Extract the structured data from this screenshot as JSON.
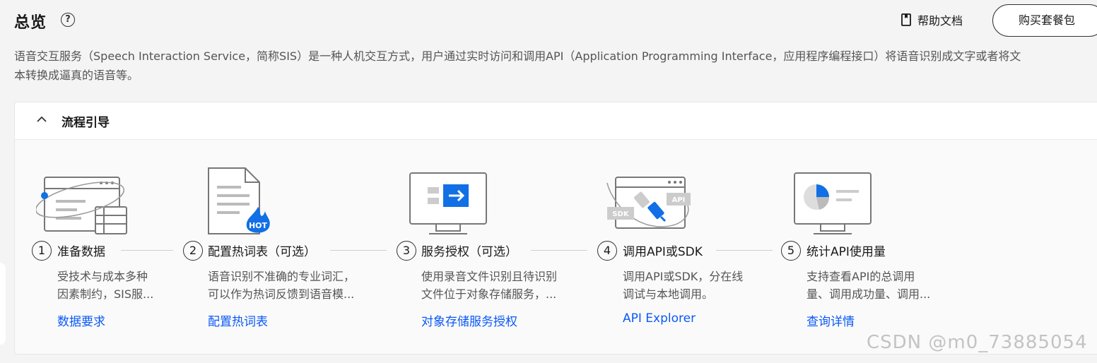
{
  "header": {
    "title": "总览",
    "help_icon": "question-circle-icon",
    "help_doc_label": "帮助文档",
    "buy_button_label": "购买套餐包"
  },
  "description": {
    "line1": "语音交互服务（Speech Interaction Service，简称SIS）是一种人机交互方式，用户通过实时访问和调用API（Application Programming Interface，应用程序编程接口）将语音识别成文字或者将文",
    "line2": "本转换成逼真的语音等。"
  },
  "panel": {
    "title": "流程引导",
    "steps": [
      {
        "number": "1",
        "title": "准备数据",
        "desc_line1": "受技术与成本多种",
        "desc_line2": "因素制约，SIS服...",
        "link": "数据要求"
      },
      {
        "number": "2",
        "title": "配置热词表（可选）",
        "desc_line1": "语音识别不准确的专业词汇，",
        "desc_line2": "可以作为热词反馈到语音模...",
        "link": "配置热词表",
        "badge": "HOT"
      },
      {
        "number": "3",
        "title": "服务授权（可选）",
        "desc_line1": "使用录音文件识别且待识别",
        "desc_line2": "文件位于对象存储服务，...",
        "link": "对象存储服务授权"
      },
      {
        "number": "4",
        "title": "调用API或SDK",
        "desc_line1": "调用API或SDK，分在线",
        "desc_line2": "调试与本地调用。",
        "link": "API Explorer",
        "badge_sdk": "SDK",
        "badge_api": "API"
      },
      {
        "number": "5",
        "title": "统计API使用量",
        "desc_line1": "支持查看API的总调用",
        "desc_line2": "量、调用成功量、调用...",
        "link": "查询详情"
      }
    ]
  },
  "watermark": "CSDN @m0_73885054",
  "colors": {
    "link": "#0a59f7",
    "accent_blue": "#1170e5",
    "background": "#f4f4f4"
  }
}
